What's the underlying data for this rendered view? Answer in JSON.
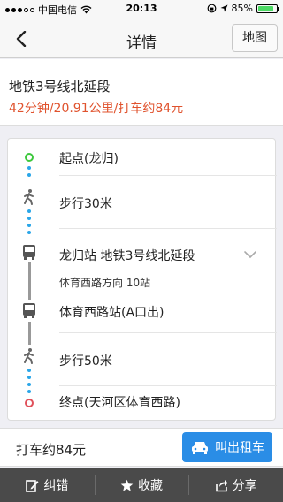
{
  "status_bar": {
    "carrier": "中国电信",
    "time": "20:13",
    "battery": "85%",
    "battery_level": 0.85
  },
  "nav": {
    "title": "详情",
    "map_button": "地图"
  },
  "summary": {
    "route_name": "地铁3号线北延段",
    "meta": "42分钟/20.91公里/打车约84元"
  },
  "steps": [
    {
      "label": "起点(龙归)"
    },
    {
      "label": "步行30米"
    },
    {
      "label": "龙归站 地铁3号线北延段",
      "sub": "体育西路方向 10站"
    },
    {
      "label": "体育西路站(A口出)"
    },
    {
      "label": "步行50米"
    },
    {
      "label": "终点(天河区体育西路)"
    }
  ],
  "taxi": {
    "price": "打车约84元",
    "button": "叫出租车"
  },
  "toolbar": {
    "report": "纠错",
    "favorite": "收藏",
    "share": "分享"
  },
  "colors": {
    "accent": "#1e8fe0",
    "taxi_button": "#2a8de6",
    "walk_dots": "#2aa6e8",
    "start_ring": "#3cc83c",
    "end_ring": "#e0505a",
    "orange_text": "#e0532e",
    "toolbar_bg": "#4a4a4a"
  }
}
